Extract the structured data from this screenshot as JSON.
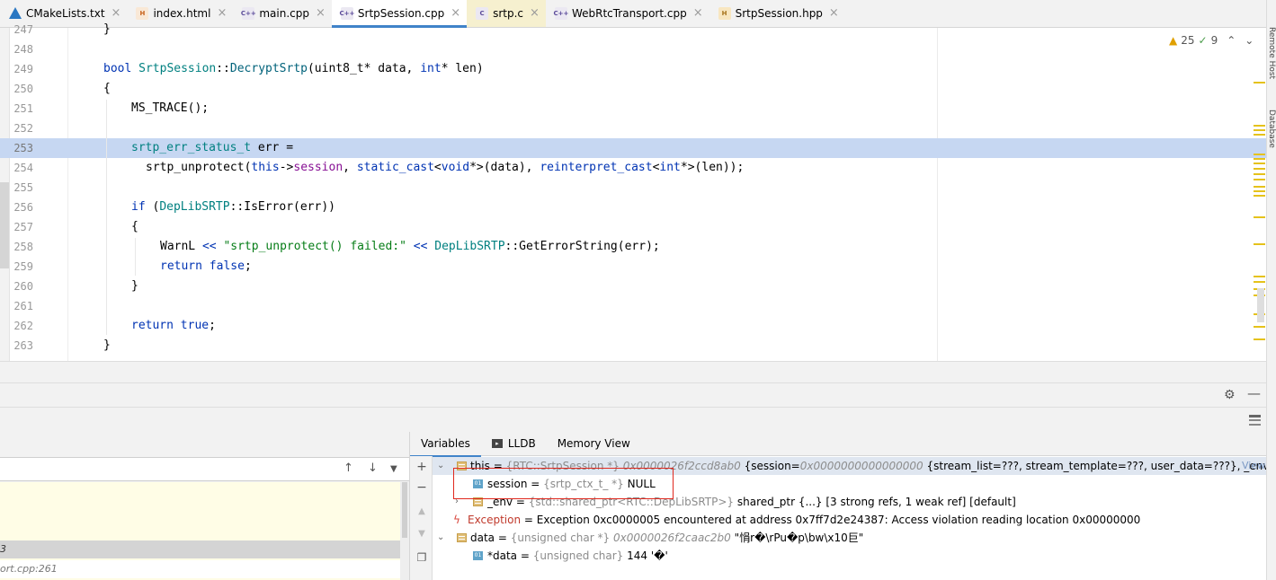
{
  "tabs": [
    {
      "label": "CMakeLists.txt",
      "icon": "cmake-icon",
      "active": false
    },
    {
      "label": "index.html",
      "icon": "html-file-icon",
      "active": false
    },
    {
      "label": "main.cpp",
      "icon": "cpp-file-icon",
      "active": false
    },
    {
      "label": "SrtpSession.cpp",
      "icon": "cpp-file-icon",
      "active": true
    },
    {
      "label": "srtp.c",
      "icon": "c-file-icon",
      "active": false
    },
    {
      "label": "WebRtcTransport.cpp",
      "icon": "cpp-file-icon",
      "active": false
    },
    {
      "label": "SrtpSession.hpp",
      "icon": "hpp-file-icon",
      "active": false
    }
  ],
  "tab_icon_letters": {
    "cpp": "C++",
    "hpp": "H",
    "c": "C",
    "html": "H"
  },
  "side_tools": [
    "Remote Host",
    "Database"
  ],
  "editor": {
    "line_numbers": [
      "247",
      "248",
      "249",
      "250",
      "251",
      "252",
      "253",
      "254",
      "255",
      "256",
      "257",
      "258",
      "259",
      "260",
      "261",
      "262",
      "263"
    ],
    "highlighted_line": "253",
    "lines": {
      "l247": "}",
      "l249": {
        "kw": "bool",
        "cls": "SrtpSession",
        "sep": "::",
        "fn": "DecryptSrtp",
        "args1": "(uint8_t* data, ",
        "kw2": "int",
        "args2": "* len)"
      },
      "l250": "{",
      "l251": "MS_TRACE();",
      "l253": {
        "ty": "srtp_err_status_t",
        "rest": " err ="
      },
      "l254": {
        "a": "srtp_unprotect(",
        "kw1": "this",
        "b": "->",
        "f1": "session",
        "c": ", ",
        "k2": "static_cast",
        "d": "<",
        "k3": "void",
        "e": "*>(data), ",
        "k4": "reinterpret_cast",
        "f": "<",
        "k5": "int",
        "g": "*>(len));"
      },
      "l256": {
        "kw": "if",
        "a": " (",
        "ns": "DepLibSRTP",
        "b": "::IsError(err))"
      },
      "l257": "{",
      "l258": {
        "a": "WarnL ",
        "op1": "<<",
        "str": " \"srtp_unprotect() failed:\" ",
        "op2": "<<",
        "ns": " DepLibSRTP",
        "b": "::GetErrorString(err);"
      },
      "l259": {
        "kw": "return",
        "kw2": " false",
        "b": ";"
      },
      "l260": "}",
      "l262": {
        "kw": "return",
        "kw2": " true",
        "b": ";"
      },
      "l263": "}"
    },
    "inspections": {
      "warnings": "25",
      "weak_warnings": "9"
    }
  },
  "frames": {
    "selected_frame_suffix": "3",
    "second_frame": "ort.cpp:261"
  },
  "variables_panel": {
    "tabs": [
      "Variables",
      "LLDB",
      "Memory View"
    ],
    "rows": [
      {
        "name": "this",
        "eq": " = ",
        "type": "{RTC::SrtpSession *}",
        "addr": " 0x0000026f2ccd8ab0",
        "val": " {session=",
        "val_addr": "0x0000000000000000",
        "val2": " {stream_list=???, stream_template=???, user_data=???}, _env=sha...",
        "view": "View"
      },
      {
        "name": "session",
        "eq": " = ",
        "type": "{srtp_ctx_t_ *}",
        "val": " NULL"
      },
      {
        "name": "_env",
        "eq": " = ",
        "type": "{std::shared_ptr<RTC::DepLibSRTP>}",
        "val": " shared_ptr {...} [3 strong refs, 1 weak ref] [default]"
      },
      {
        "name": "Exception",
        "eq": " = ",
        "val": "Exception 0xc0000005 encountered at address 0x7ff7d2e24387: Access violation reading location 0x00000000"
      },
      {
        "name": "data",
        "eq": " = ",
        "type": "{unsigned char *}",
        "addr": " 0x0000026f2caac2b0",
        "val": " \"悁r�\\rPu�p\\bw\\x10巨\""
      },
      {
        "name": "*data",
        "eq": " = ",
        "type": "{unsigned char}",
        "val": " 144 '�'"
      }
    ]
  }
}
